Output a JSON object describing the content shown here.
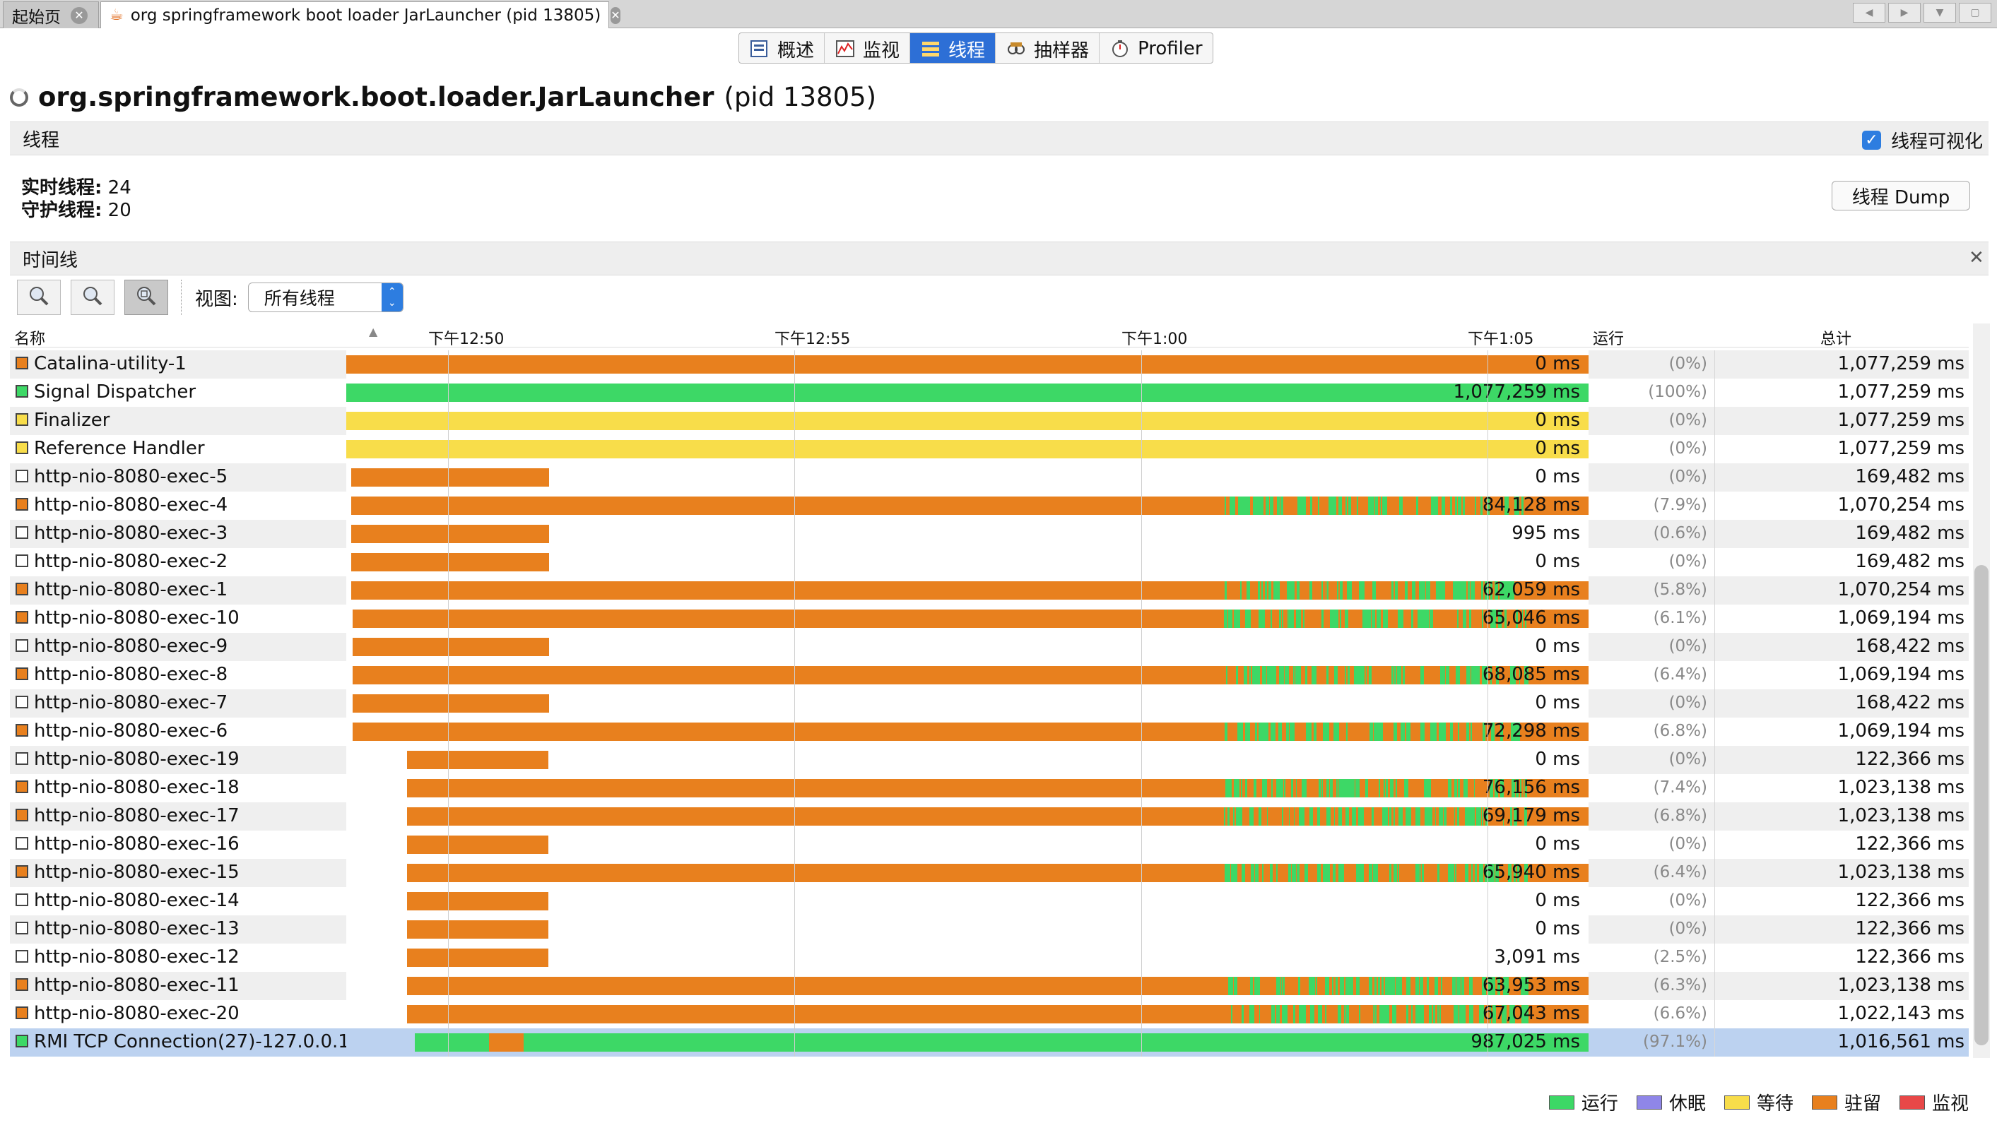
{
  "tabs": {
    "start_label": "起始页",
    "main_label": "org springframework boot loader JarLauncher (pid 13805)"
  },
  "subtabs": [
    {
      "label": "概述"
    },
    {
      "label": "监视"
    },
    {
      "label": "线程"
    },
    {
      "label": "抽样器"
    },
    {
      "label": "Profiler"
    }
  ],
  "header": {
    "app": "org.springframework.boot.loader.JarLauncher",
    "pid": "(pid 13805)"
  },
  "threads_section": {
    "title": "线程",
    "visualize_label": "线程可视化",
    "visualize_checked": true
  },
  "stats": {
    "live_label": "实时线程:",
    "live_value": "24",
    "daemon_label": "守护线程:",
    "daemon_value": "20"
  },
  "dump_button": "线程 Dump",
  "timeline": {
    "title": "时间线",
    "view_label": "视图:",
    "view_value": "所有线程"
  },
  "columns": {
    "name": "名称",
    "running": "运行",
    "total": "总计"
  },
  "time_ticks": [
    "下午12:50",
    "下午12:55",
    "下午1:00",
    "下午1:05"
  ],
  "colors": {
    "running": "#3dd866",
    "sleeping": "#8f86e8",
    "waiting": "#f8dd4a",
    "parked": "#e8801e",
    "monitor": "#e84848",
    "selected": "#bcd2f0"
  },
  "legend": [
    {
      "label": "运行",
      "state": "running"
    },
    {
      "label": "休眠",
      "state": "sleeping"
    },
    {
      "label": "等待",
      "state": "waiting"
    },
    {
      "label": "驻留",
      "state": "parked"
    },
    {
      "label": "监视",
      "state": "monitor"
    }
  ],
  "threads": [
    {
      "name": "Catalina-utility-1",
      "state": "parked",
      "run": "0 ms",
      "pct": "(0%)",
      "total": "1,077,259 ms",
      "start": 0.0,
      "end": 1.0,
      "bar": "parked",
      "green": 0
    },
    {
      "name": "Signal Dispatcher",
      "state": "running",
      "run": "1,077,259 ms",
      "pct": "(100%)",
      "total": "1,077,259 ms",
      "start": 0.0,
      "end": 1.0,
      "bar": "running",
      "green": 0
    },
    {
      "name": "Finalizer",
      "state": "waiting",
      "run": "0 ms",
      "pct": "(0%)",
      "total": "1,077,259 ms",
      "start": 0.0,
      "end": 1.0,
      "bar": "waiting",
      "green": 0
    },
    {
      "name": "Reference Handler",
      "state": "waiting",
      "run": "0 ms",
      "pct": "(0%)",
      "total": "1,077,259 ms",
      "start": 0.0,
      "end": 1.0,
      "bar": "waiting",
      "green": 0
    },
    {
      "name": "http-nio-8080-exec-5",
      "state": "none",
      "run": "0 ms",
      "pct": "(0%)",
      "total": "169,482 ms",
      "start": 0.004,
      "end": 0.163,
      "bar": "parked",
      "green": 0
    },
    {
      "name": "http-nio-8080-exec-4",
      "state": "parked",
      "run": "84,128 ms",
      "pct": "(7.9%)",
      "total": "1,070,254 ms",
      "start": 0.004,
      "end": 1.0,
      "bar": "parked",
      "green": 1
    },
    {
      "name": "http-nio-8080-exec-3",
      "state": "none",
      "run": "995 ms",
      "pct": "(0.6%)",
      "total": "169,482 ms",
      "start": 0.004,
      "end": 0.163,
      "bar": "parked",
      "green": 0
    },
    {
      "name": "http-nio-8080-exec-2",
      "state": "none",
      "run": "0 ms",
      "pct": "(0%)",
      "total": "169,482 ms",
      "start": 0.004,
      "end": 0.163,
      "bar": "parked",
      "green": 0
    },
    {
      "name": "http-nio-8080-exec-1",
      "state": "parked",
      "run": "62,059 ms",
      "pct": "(5.8%)",
      "total": "1,070,254 ms",
      "start": 0.004,
      "end": 1.0,
      "bar": "parked",
      "green": 1
    },
    {
      "name": "http-nio-8080-exec-10",
      "state": "parked",
      "run": "65,046 ms",
      "pct": "(6.1%)",
      "total": "1,069,194 ms",
      "start": 0.005,
      "end": 1.0,
      "bar": "parked",
      "green": 1
    },
    {
      "name": "http-nio-8080-exec-9",
      "state": "none",
      "run": "0 ms",
      "pct": "(0%)",
      "total": "168,422 ms",
      "start": 0.005,
      "end": 0.163,
      "bar": "parked",
      "green": 0
    },
    {
      "name": "http-nio-8080-exec-8",
      "state": "parked",
      "run": "68,085 ms",
      "pct": "(6.4%)",
      "total": "1,069,194 ms",
      "start": 0.005,
      "end": 1.0,
      "bar": "parked",
      "green": 1
    },
    {
      "name": "http-nio-8080-exec-7",
      "state": "none",
      "run": "0 ms",
      "pct": "(0%)",
      "total": "168,422 ms",
      "start": 0.005,
      "end": 0.163,
      "bar": "parked",
      "green": 0
    },
    {
      "name": "http-nio-8080-exec-6",
      "state": "parked",
      "run": "72,298 ms",
      "pct": "(6.8%)",
      "total": "1,069,194 ms",
      "start": 0.005,
      "end": 1.0,
      "bar": "parked",
      "green": 1
    },
    {
      "name": "http-nio-8080-exec-19",
      "state": "none",
      "run": "0 ms",
      "pct": "(0%)",
      "total": "122,366 ms",
      "start": 0.049,
      "end": 0.163,
      "bar": "parked",
      "green": 0
    },
    {
      "name": "http-nio-8080-exec-18",
      "state": "parked",
      "run": "76,156 ms",
      "pct": "(7.4%)",
      "total": "1,023,138 ms",
      "start": 0.049,
      "end": 1.0,
      "bar": "parked",
      "green": 1
    },
    {
      "name": "http-nio-8080-exec-17",
      "state": "parked",
      "run": "69,179 ms",
      "pct": "(6.8%)",
      "total": "1,023,138 ms",
      "start": 0.049,
      "end": 1.0,
      "bar": "parked",
      "green": 1
    },
    {
      "name": "http-nio-8080-exec-16",
      "state": "none",
      "run": "0 ms",
      "pct": "(0%)",
      "total": "122,366 ms",
      "start": 0.049,
      "end": 0.163,
      "bar": "parked",
      "green": 0
    },
    {
      "name": "http-nio-8080-exec-15",
      "state": "parked",
      "run": "65,940 ms",
      "pct": "(6.4%)",
      "total": "1,023,138 ms",
      "start": 0.049,
      "end": 1.0,
      "bar": "parked",
      "green": 1
    },
    {
      "name": "http-nio-8080-exec-14",
      "state": "none",
      "run": "0 ms",
      "pct": "(0%)",
      "total": "122,366 ms",
      "start": 0.049,
      "end": 0.163,
      "bar": "parked",
      "green": 0
    },
    {
      "name": "http-nio-8080-exec-13",
      "state": "none",
      "run": "0 ms",
      "pct": "(0%)",
      "total": "122,366 ms",
      "start": 0.049,
      "end": 0.163,
      "bar": "parked",
      "green": 0
    },
    {
      "name": "http-nio-8080-exec-12",
      "state": "none",
      "run": "3,091 ms",
      "pct": "(2.5%)",
      "total": "122,366 ms",
      "start": 0.049,
      "end": 0.163,
      "bar": "parked",
      "green": 0
    },
    {
      "name": "http-nio-8080-exec-11",
      "state": "parked",
      "run": "63,953 ms",
      "pct": "(6.3%)",
      "total": "1,023,138 ms",
      "start": 0.049,
      "end": 1.0,
      "bar": "parked",
      "green": 1
    },
    {
      "name": "http-nio-8080-exec-20",
      "state": "parked",
      "run": "67,043 ms",
      "pct": "(6.6%)",
      "total": "1,022,143 ms",
      "start": 0.049,
      "end": 1.0,
      "bar": "parked",
      "green": 1
    },
    {
      "name": "RMI TCP Connection(27)-127.0.0.1",
      "state": "running",
      "run": "987,025 ms",
      "pct": "(97.1%)",
      "total": "1,016,561 ms",
      "start": 0.055,
      "end": 1.0,
      "bar": "running",
      "green": 0,
      "selected": true
    }
  ]
}
